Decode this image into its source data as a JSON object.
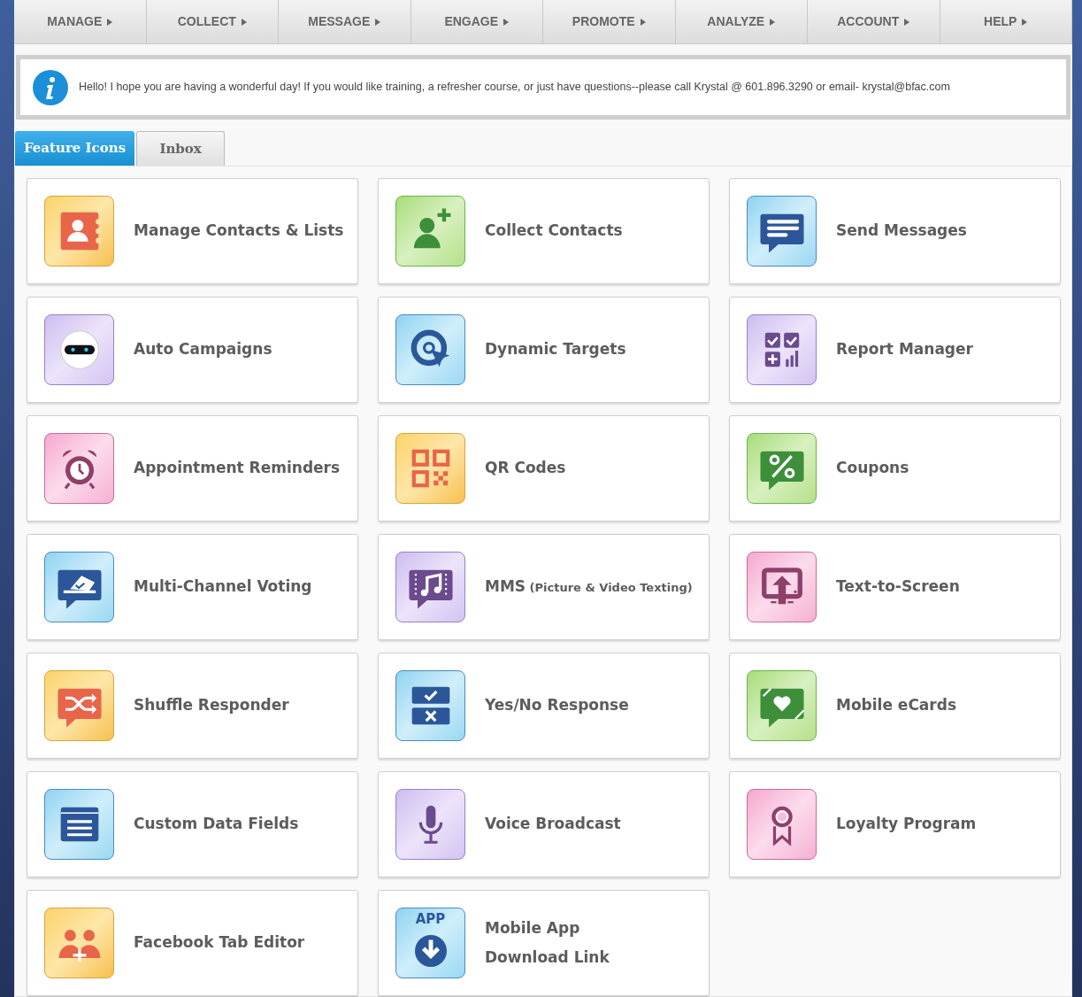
{
  "nav": [
    {
      "label": "MANAGE"
    },
    {
      "label": "COLLECT"
    },
    {
      "label": "MESSAGE"
    },
    {
      "label": "ENGAGE"
    },
    {
      "label": "PROMOTE"
    },
    {
      "label": "ANALYZE"
    },
    {
      "label": "ACCOUNT"
    },
    {
      "label": "HELP"
    }
  ],
  "notice": "Hello! I hope you are having a wonderful day! If you would like training, a refresher course, or just have questions--please call Krystal @ 601.896.3290 or email- krystal@bfac.com",
  "tabs": [
    {
      "label": "Feature Icons",
      "selected": true
    },
    {
      "label": "Inbox",
      "selected": false
    }
  ],
  "features": [
    {
      "title": "Manage Contacts & Lists"
    },
    {
      "title": "Collect Contacts"
    },
    {
      "title": "Send Messages"
    },
    {
      "title": "Auto Campaigns"
    },
    {
      "title": "Dynamic Targets"
    },
    {
      "title": "Report Manager"
    },
    {
      "title": "Appointment Reminders"
    },
    {
      "title": "QR Codes"
    },
    {
      "title": "Coupons"
    },
    {
      "title": "Multi-Channel Voting"
    },
    {
      "title": "MMS",
      "note": "(Picture & Video Texting)"
    },
    {
      "title": "Text-to-Screen"
    },
    {
      "title": "Shuffle Responder"
    },
    {
      "title": "Yes/No Response"
    },
    {
      "title": "Mobile eCards"
    },
    {
      "title": "Custom Data Fields"
    },
    {
      "title": "Voice Broadcast"
    },
    {
      "title": "Loyalty Program"
    },
    {
      "title": "Facebook Tab Editor"
    },
    {
      "title": "Mobile App",
      "title_line_2": "Download Link",
      "badge": "APP"
    }
  ]
}
